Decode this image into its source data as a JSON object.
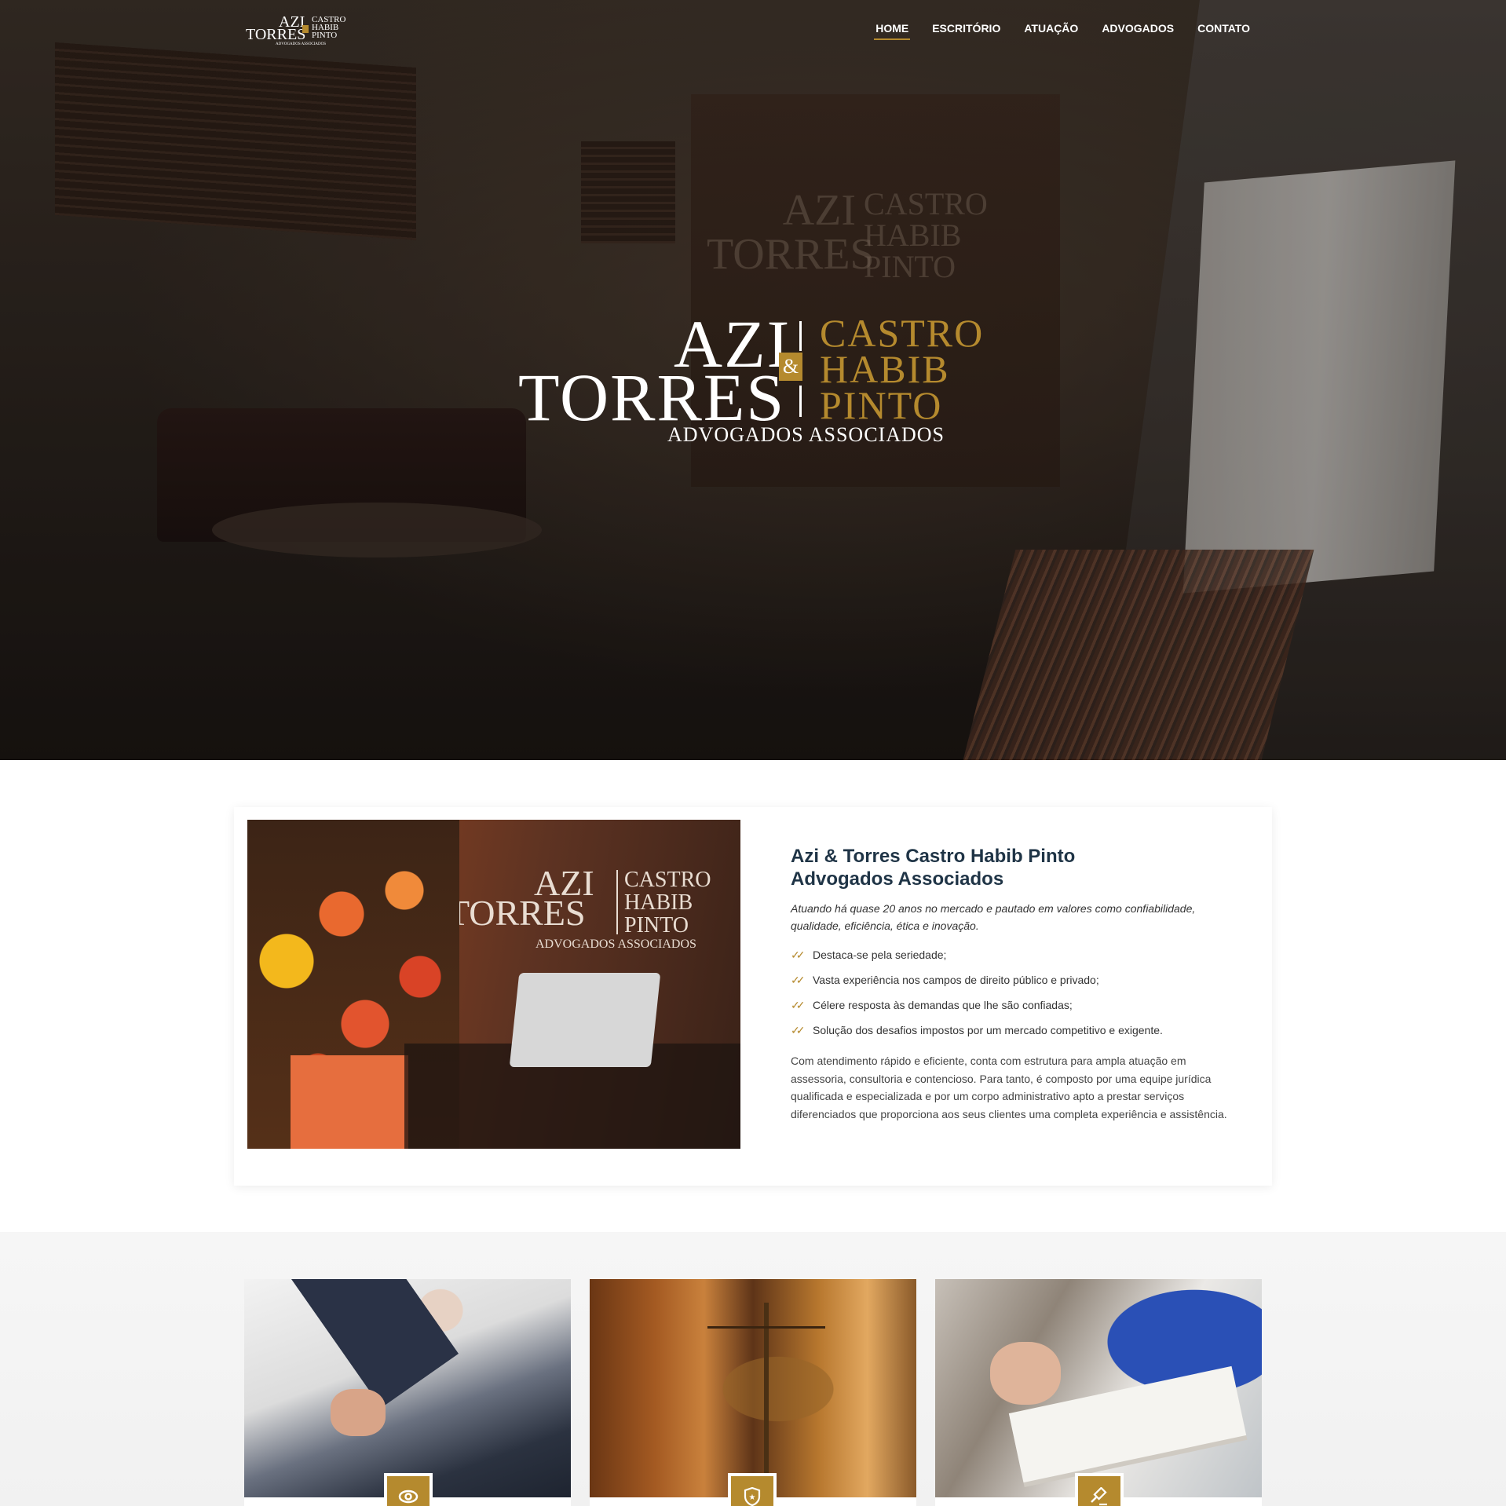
{
  "nav": {
    "logo": {
      "line1": "AZI",
      "line2": "TORRES",
      "right": [
        "CASTRO",
        "HABIB",
        "PINTO"
      ],
      "sub": "ADVOGADOS ASSOCIADOS"
    },
    "items": [
      {
        "label": "HOME",
        "active": true
      },
      {
        "label": "ESCRITÓRIO",
        "active": false
      },
      {
        "label": "ATUAÇÃO",
        "active": false
      },
      {
        "label": "ADVOGADOS",
        "active": false
      },
      {
        "label": "CONTATO",
        "active": false
      }
    ]
  },
  "hero": {
    "logo": {
      "left_top": "AZI",
      "left_bottom": "TORRES",
      "ampersand": "&",
      "right": [
        "CASTRO",
        "HABIB",
        "PINTO"
      ],
      "subtitle": "ADVOGADOS ASSOCIADOS"
    }
  },
  "about": {
    "image_wall_text": {
      "left_top": "AZI",
      "left_bottom": "TORRES",
      "right": [
        "CASTRO",
        "HABIB",
        "PINTO"
      ],
      "subtitle": "ADVOGADOS ASSOCIADOS"
    },
    "title_line1": "Azi & Torres Castro Habib Pinto",
    "title_line2": "Advogados Associados",
    "lead": "Atuando há quase 20 anos no mercado e pautado em valores como confiabilidade, qualidade, eficiência, ética e inovação.",
    "bullets": [
      "Destaca-se pela seriedade;",
      "Vasta experiência nos campos de direito público e privado;",
      "Célere resposta às demandas que lhe são confiadas;",
      "Solução dos desafios impostos por um mercado competitivo e exigente."
    ],
    "body": "Com atendimento rápido e eficiente, conta com estrutura para ampla atuação em assessoria, consultoria e contencioso. Para tanto, é composto por uma equipe jurídica qualificada e especializada e por um corpo administrativo apto a prestar serviços diferenciados que proporciona aos seus clientes uma completa experiência e assistência."
  },
  "features": {
    "cards": [
      {
        "photo": "handshake-photo",
        "icon": "eye-icon"
      },
      {
        "photo": "scales-of-justice-photo",
        "icon": "shield-star-icon"
      },
      {
        "photo": "reading-book-photo",
        "icon": "gavel-icon"
      }
    ]
  },
  "colors": {
    "accent_gold": "#b58a2e",
    "title_navy": "#1f3446",
    "section_bg": "#f4f4f4"
  }
}
